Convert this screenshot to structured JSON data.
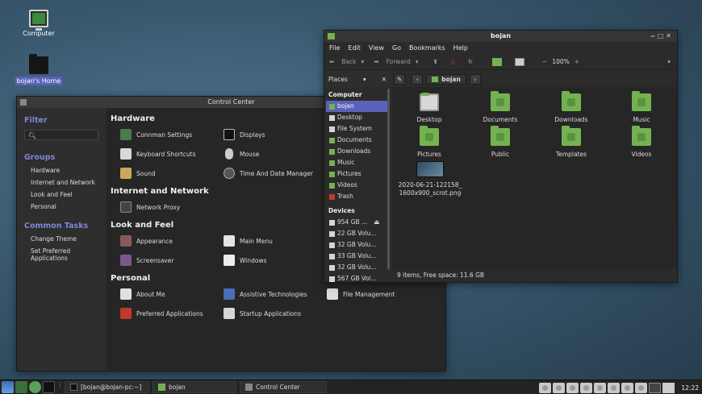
{
  "desktop": {
    "icons": [
      {
        "label": "Computer"
      },
      {
        "label": "bojan's Home"
      }
    ]
  },
  "control_center": {
    "title": "Control Center",
    "filter_label": "Filter",
    "groups_label": "Groups",
    "groups": [
      "Hardware",
      "Internet and Network",
      "Look and Feel",
      "Personal"
    ],
    "common_tasks_label": "Common Tasks",
    "common_tasks": [
      "Change Theme",
      "Set Preferred Applications"
    ],
    "sections": [
      {
        "title": "Hardware",
        "items": [
          "Connman Settings",
          "Displays",
          "Keyboard Shortcuts",
          "Mouse",
          "Sound",
          "Time And Date Manager"
        ]
      },
      {
        "title": "Internet and Network",
        "items": [
          "Network Proxy"
        ]
      },
      {
        "title": "Look and Feel",
        "items": [
          "Appearance",
          "Main Menu",
          "Screensaver",
          "Windows"
        ]
      },
      {
        "title": "Personal",
        "items": [
          "About Me",
          "Assistive Technologies",
          "File Management",
          "Preferred Applications",
          "Startup Applications"
        ]
      }
    ]
  },
  "file_manager": {
    "title": "bojan",
    "menu": [
      "File",
      "Edit",
      "View",
      "Go",
      "Bookmarks",
      "Help"
    ],
    "toolbar": {
      "back": "Back",
      "forward": "Forward",
      "zoom": "100%"
    },
    "places_label": "Places",
    "path_current": "bojan",
    "computer_label": "Computer",
    "computer_items": [
      "bojan",
      "Desktop",
      "File System",
      "Documents",
      "Downloads",
      "Music",
      "Pictures",
      "Videos",
      "Trash"
    ],
    "devices_label": "Devices",
    "devices": [
      "954 GB ...",
      "22 GB Volu...",
      "32 GB Volu...",
      "33 GB Volu...",
      "32 GB Volu...",
      "567 GB Vol..."
    ],
    "files": [
      "Desktop",
      "Documents",
      "Downloads",
      "Music",
      "Pictures",
      "Public",
      "Templates",
      "Videos",
      "2020-06-21-122158_1600x900_scrot.png"
    ],
    "status": "9 items, Free space: 11.6 GB"
  },
  "taskbar": {
    "tasks": [
      "[bojan@bojan-pc:~]",
      "bojan",
      "Control Center"
    ],
    "clock": "12:22"
  }
}
